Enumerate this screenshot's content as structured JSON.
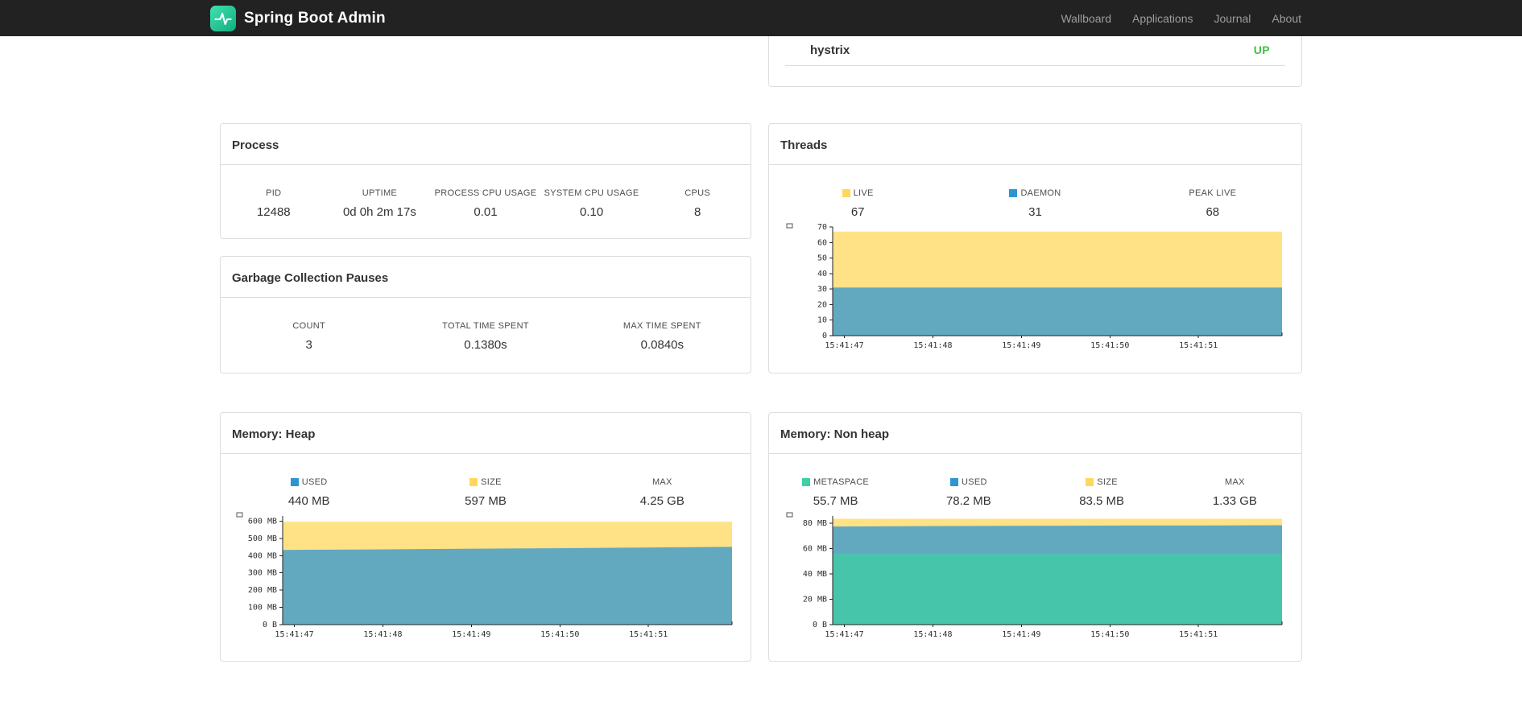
{
  "navbar": {
    "brand": "Spring Boot Admin",
    "links": [
      "Wallboard",
      "Applications",
      "Journal",
      "About"
    ]
  },
  "health_card": {
    "name": "hystrix",
    "status": "UP",
    "status_color": "#42c142"
  },
  "process": {
    "title": "Process",
    "stats": [
      {
        "label": "PID",
        "value": "12488"
      },
      {
        "label": "UPTIME",
        "value": "0d 0h 2m 17s"
      },
      {
        "label": "PROCESS CPU USAGE",
        "value": "0.01"
      },
      {
        "label": "SYSTEM CPU USAGE",
        "value": "0.10"
      },
      {
        "label": "CPUS",
        "value": "8"
      }
    ]
  },
  "gc": {
    "title": "Garbage Collection Pauses",
    "stats": [
      {
        "label": "COUNT",
        "value": "3"
      },
      {
        "label": "TOTAL TIME SPENT",
        "value": "0.1380s"
      },
      {
        "label": "MAX TIME SPENT",
        "value": "0.0840s"
      }
    ]
  },
  "threads": {
    "title": "Threads",
    "legend": [
      {
        "label": "LIVE",
        "value": "67",
        "color": "#ffd75e"
      },
      {
        "label": "DAEMON",
        "value": "31",
        "color": "#2e95d3"
      },
      {
        "label": "PEAK LIVE",
        "value": "68",
        "color": null
      }
    ]
  },
  "heap": {
    "title": "Memory: Heap",
    "legend": [
      {
        "label": "USED",
        "value": "440 MB",
        "color": "#2e95d3"
      },
      {
        "label": "SIZE",
        "value": "597 MB",
        "color": "#ffd75e"
      },
      {
        "label": "MAX",
        "value": "4.25 GB",
        "color": null
      }
    ]
  },
  "nonheap": {
    "title": "Memory: Non heap",
    "legend": [
      {
        "label": "METASPACE",
        "value": "55.7 MB",
        "color": "#3fcfa4"
      },
      {
        "label": "USED",
        "value": "78.2 MB",
        "color": "#2e95d3"
      },
      {
        "label": "SIZE",
        "value": "83.5 MB",
        "color": "#ffd75e"
      },
      {
        "label": "MAX",
        "value": "1.33 GB",
        "color": null
      }
    ]
  },
  "chart_data": [
    {
      "id": "threads",
      "type": "area",
      "title": "Threads",
      "stacked_visual": "overlaid areas, larger drawn behind",
      "x": [
        "15:41:47",
        "15:41:48",
        "15:41:49",
        "15:41:50",
        "15:41:51"
      ],
      "ylim": [
        0,
        70
      ],
      "yticks": [
        {
          "value": 0,
          "label": "0"
        },
        {
          "value": 10,
          "label": "10"
        },
        {
          "value": 20,
          "label": "20"
        },
        {
          "value": 30,
          "label": "30"
        },
        {
          "value": 40,
          "label": "40"
        },
        {
          "value": 50,
          "label": "50"
        },
        {
          "value": 60,
          "label": "60"
        },
        {
          "value": 70,
          "label": "70"
        }
      ],
      "series": [
        {
          "name": "LIVE",
          "color": "#ffd75e",
          "values": [
            67,
            67,
            67,
            67,
            67,
            67
          ]
        },
        {
          "name": "DAEMON",
          "color": "#2e95d3",
          "values": [
            31,
            31,
            31,
            31,
            31,
            31
          ]
        }
      ]
    },
    {
      "id": "heap",
      "type": "area",
      "title": "Memory: Heap",
      "stacked_visual": "overlaid areas, larger drawn behind",
      "x": [
        "15:41:47",
        "15:41:48",
        "15:41:49",
        "15:41:50",
        "15:41:51"
      ],
      "ylim": [
        0,
        630
      ],
      "yticks": [
        {
          "value": 0,
          "label": "0 B"
        },
        {
          "value": 100,
          "label": "100 MB"
        },
        {
          "value": 200,
          "label": "200 MB"
        },
        {
          "value": 300,
          "label": "300 MB"
        },
        {
          "value": 400,
          "label": "400 MB"
        },
        {
          "value": 500,
          "label": "500 MB"
        },
        {
          "value": 600,
          "label": "600 MB"
        }
      ],
      "series": [
        {
          "name": "SIZE",
          "color": "#ffd75e",
          "values": [
            597,
            597,
            597,
            597,
            597,
            597
          ]
        },
        {
          "name": "USED",
          "color": "#2e95d3",
          "values": [
            433,
            436,
            440,
            443,
            447,
            451
          ]
        }
      ]
    },
    {
      "id": "nonheap",
      "type": "area",
      "title": "Memory: Non heap",
      "stacked_visual": "overlaid areas, larger drawn behind",
      "x": [
        "15:41:47",
        "15:41:48",
        "15:41:49",
        "15:41:50",
        "15:41:51"
      ],
      "ylim": [
        0,
        85.7
      ],
      "yticks": [
        {
          "value": 0,
          "label": "0 B"
        },
        {
          "value": 20,
          "label": "20 MB"
        },
        {
          "value": 40,
          "label": "40 MB"
        },
        {
          "value": 60,
          "label": "60 MB"
        },
        {
          "value": 80,
          "label": "80 MB"
        }
      ],
      "series": [
        {
          "name": "SIZE",
          "color": "#ffd75e",
          "values": [
            83.5,
            83.5,
            83.5,
            83.5,
            83.5,
            83.5
          ]
        },
        {
          "name": "USED",
          "color": "#2e95d3",
          "values": [
            77.4,
            77.7,
            77.9,
            78.1,
            78.2,
            78.4
          ]
        },
        {
          "name": "METASPACE",
          "color": "#3fcfa4",
          "values": [
            55.7,
            55.7,
            55.7,
            55.7,
            55.7,
            55.7
          ]
        }
      ]
    }
  ]
}
